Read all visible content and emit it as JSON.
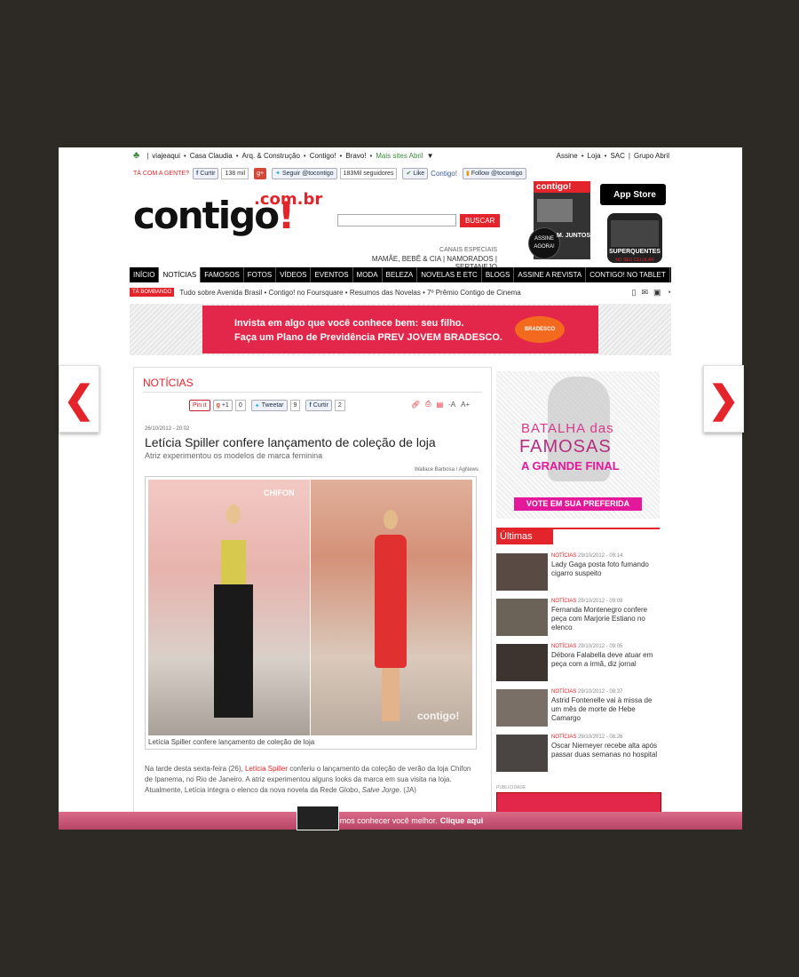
{
  "topbar": {
    "sites": [
      "viajeaqui",
      "Casa Claudia",
      "Arq. & Construção",
      "Contigo!",
      "Bravo!"
    ],
    "mais_sites": "Mais sites Abril",
    "right": [
      "Assine",
      "Loja",
      "SAC"
    ],
    "grupo": "Grupo Abril"
  },
  "social": {
    "tacom": "TÁ COM A GENTE?",
    "curtir": "Curtir",
    "curtir_count": "138 mil",
    "gplus": "g+",
    "seguir": "Seguir @tocontigo",
    "seguidores": "183Mil seguidores",
    "like": "Like",
    "contigo": "Contigo!",
    "follow": "Follow @tocontigo"
  },
  "header": {
    "logo": "contigo",
    "logo_bang": "!",
    "logo_combr": ".com.br",
    "search_button": "BUSCAR",
    "canais_label": "CANAIS ESPECIAIS",
    "canais_links": "MAMÃE, BEBÊ & CIA | NAMORADOS | SERTANEJO",
    "mag_title": "contigo!",
    "mag_assine": "ASSINE AGORA!",
    "mag_juntos": "M. JUNTOS",
    "appstore": "App Store",
    "phone_text": "SUPERQUENTES",
    "phone_sub": "NO SEU CELULAR"
  },
  "nav": [
    "INÍCIO",
    "NOTÍCIAS",
    "FAMOSOS",
    "FOTOS",
    "VÍDEOS",
    "EVENTOS",
    "MODA",
    "BELEZA",
    "NOVELAS E ETC",
    "BLOGS",
    "ASSINE A REVISTA",
    "CONTIGO! NO TABLET"
  ],
  "nav_active_index": 1,
  "bombando": {
    "tag": "TÁ BOMBANDO",
    "text": "Tudo sobre Avenida Brasil • Contigo! no Foursquare • Resumos das Novelas • 7º Prêmio Contigo de Cinema"
  },
  "ad": {
    "line1": "Invista em algo que você conhece bem: seu filho.",
    "line2": "Faça um Plano de Previdência PREV JOVEM BRADESCO.",
    "logo": "BRADESCO"
  },
  "arrows": {
    "left": "❮",
    "right": "❯"
  },
  "article": {
    "section": "NOTÍCIAS",
    "share": {
      "pinit": "Pin it",
      "gplus1": "+1",
      "gplus_count": "0",
      "tweet": "Tweetar",
      "tweet_count": "9",
      "curtir": "Curtir",
      "curtir_count": "2"
    },
    "font_minus": "-A",
    "font_plus": "A+",
    "date": "26/10/2012 - 20:02",
    "headline": "Letícia Spiller confere lançamento de coleção de loja",
    "deck": "Atriz experimentou os modelos de marca feminina",
    "credit": "Wallace Barbosa / AgNews",
    "photo_store": "CHIFON",
    "photo_watermark": "contigo!",
    "photo_caption": "Letícia Spiller confere lançamento de coleção de loja",
    "body_1": "Na tarde desta sexta-feira (26), ",
    "body_link": "Letícia Spiller",
    "body_2": " conferiu o lançamento da coleção de verão da loja Chifon de Ipanema, no Rio de Janeiro. A atriz experimentou alguns looks da marca em sua visita na loja. Atualmente, Letícia integra o elenco da nova novela da Rede Globo, ",
    "body_italic": "Salve Jorge",
    "body_3": ". (JA)"
  },
  "sidebar": {
    "batalha_1": "BATALHA das",
    "batalha_2": "FAMOSAS",
    "batalha_3": "A GRANDE FINAL",
    "vote": "VOTE EM SUA PREFERIDA",
    "ultimas": "Últimas",
    "news": [
      {
        "cat": "NOTÍCIAS",
        "date": "29/10/2012 - 09:14",
        "title": "Lady Gaga posta foto fumando cigarro suspeito"
      },
      {
        "cat": "NOTÍCIAS",
        "date": "29/10/2012 - 09:09",
        "title": "Fernanda Montenegro confere peça com Marjorie Estiano no elenco"
      },
      {
        "cat": "NOTÍCIAS",
        "date": "29/10/2012 - 09:05",
        "title": "Débora Falabella deve atuar em peça com a irmã, diz jornal"
      },
      {
        "cat": "NOTÍCIAS",
        "date": "29/10/2012 - 08:37",
        "title": "Astrid Fontenelle vai à missa de um mês de morte de Hebe Camargo"
      },
      {
        "cat": "NOTÍCIAS",
        "date": "29/10/2012 - 08:26",
        "title": "Oscar Niemeyer recebe alta após passar duas semanas no hospital"
      }
    ],
    "publicidade": "PUBLICIDADE"
  },
  "cookie": {
    "text": "Queremos conhecer você melhor.",
    "link": "Clique aqui"
  },
  "colors": {
    "accent": "#e3242b",
    "background": "#2d2a25",
    "cookie_bar": "#c0506f"
  }
}
